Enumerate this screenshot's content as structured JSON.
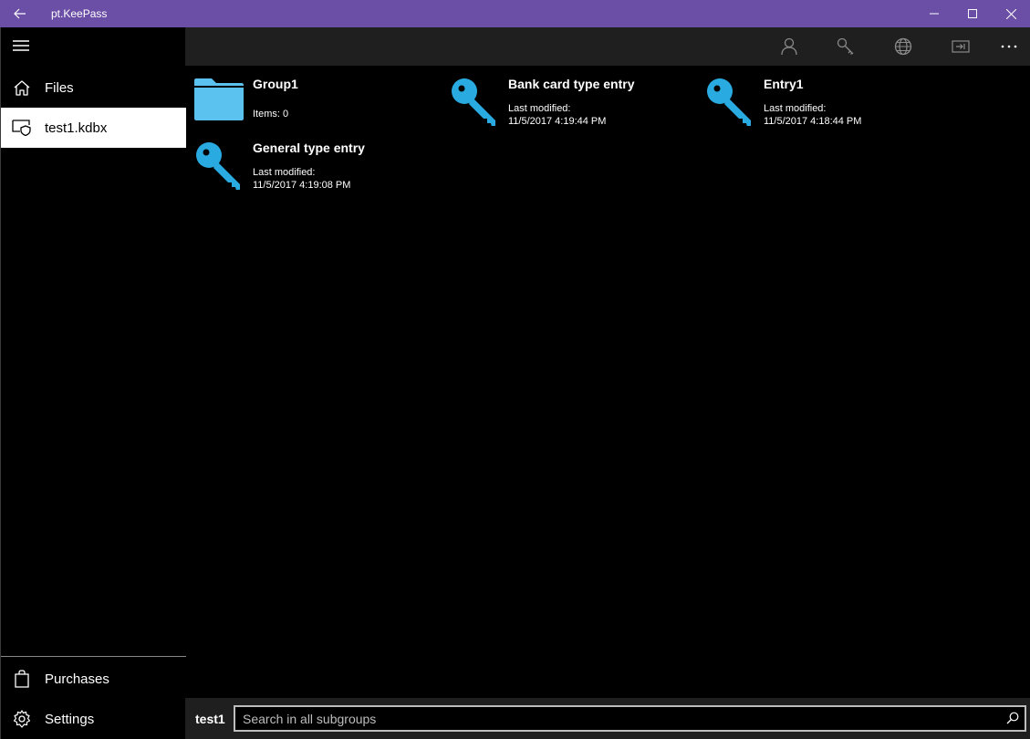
{
  "window": {
    "title": "pt.KeePass",
    "accent": "#6b4fa6"
  },
  "sidebar": {
    "menu_icon": "hamburger-icon",
    "items": [
      {
        "label": "Files",
        "icon": "home-icon"
      },
      {
        "label": "test1.kdbx",
        "icon": "database-shield-icon",
        "selected": true
      },
      {
        "label": "Purchases",
        "icon": "shopping-bag-icon"
      },
      {
        "label": "Settings",
        "icon": "gear-icon"
      }
    ]
  },
  "commandbar": {
    "buttons": [
      {
        "icon": "user-icon"
      },
      {
        "icon": "key-icon"
      },
      {
        "icon": "globe-icon"
      },
      {
        "icon": "open-entry-icon"
      },
      {
        "icon": "more-icon"
      }
    ]
  },
  "content": {
    "icon_color": "#29abe2",
    "folder_color": "#5bc2f0",
    "tiles": [
      {
        "type": "group",
        "title": "Group1",
        "items_text": "Items: 0"
      },
      {
        "type": "entry",
        "title": "Bank card type entry",
        "modified_label": "Last modified:",
        "modified_value": "11/5/2017 4:19:44 PM"
      },
      {
        "type": "entry",
        "title": "Entry1",
        "modified_label": "Last modified:",
        "modified_value": "11/5/2017 4:18:44 PM"
      },
      {
        "type": "entry",
        "title": "General type entry",
        "modified_label": "Last modified:",
        "modified_value": "11/5/2017 4:19:08 PM"
      }
    ]
  },
  "bottombar": {
    "db_name": "test1",
    "search_placeholder": "Search in all subgroups"
  }
}
